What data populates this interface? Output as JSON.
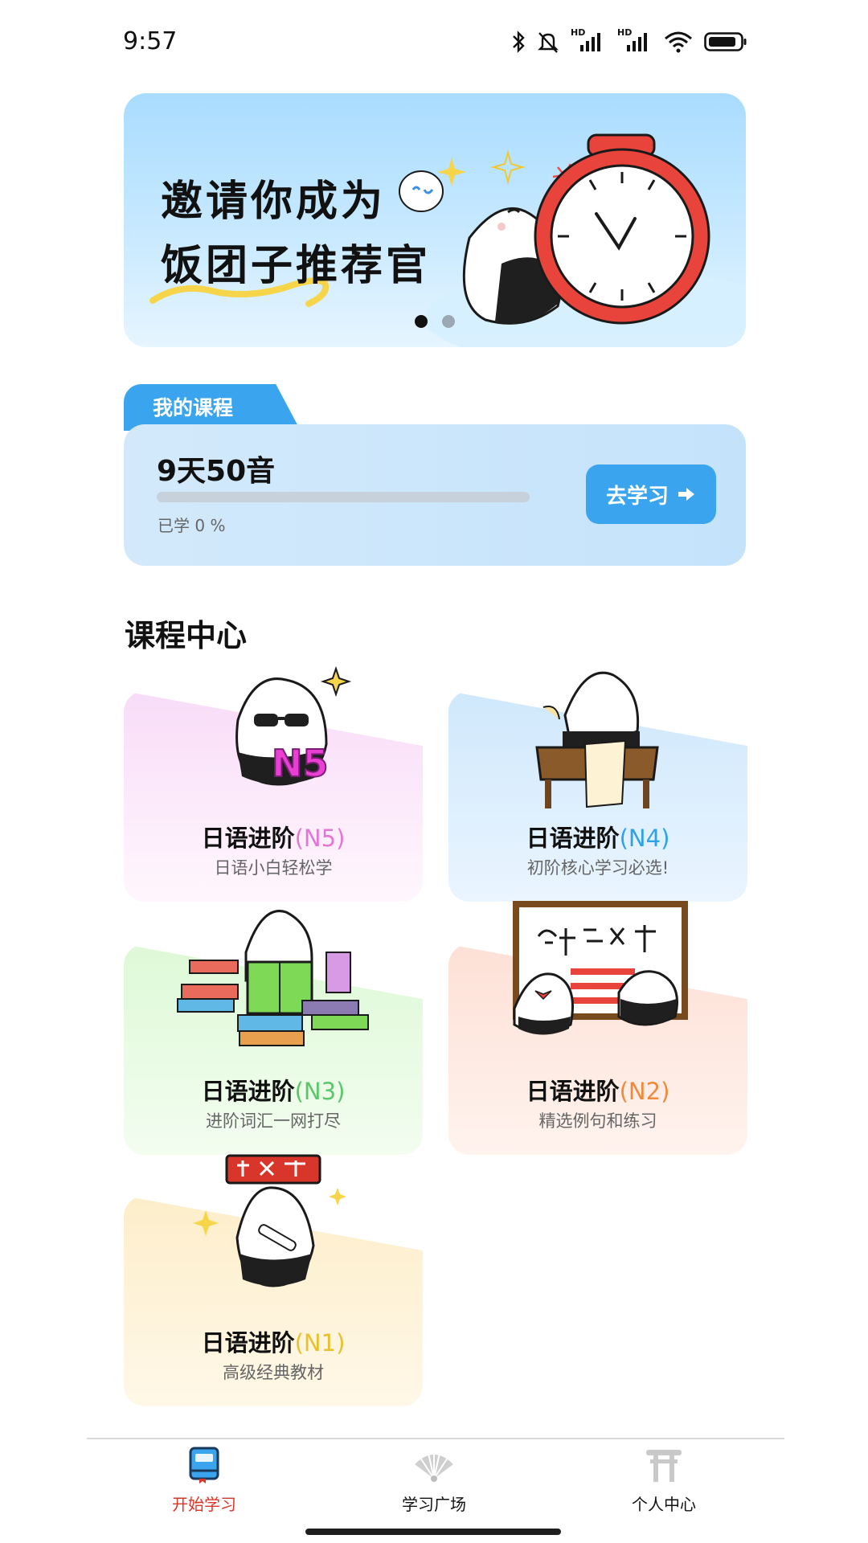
{
  "status_bar": {
    "time": "9:57",
    "icons": [
      "bluetooth-icon",
      "mute-bell-icon",
      "signal-hd-icon",
      "signal-hd-icon",
      "wifi-icon",
      "battery-icon"
    ]
  },
  "banner": {
    "line1": "邀请你成为",
    "line2": "饭团子推荐官",
    "dots": 2,
    "active_dot": 0
  },
  "my_course": {
    "tab_label": "我的课程",
    "title": "9天50音",
    "progress_text": "已学 0 %",
    "progress": 0,
    "button_label": "去学习"
  },
  "course_center": {
    "title": "课程中心",
    "courses": [
      {
        "name": "日语进阶",
        "level": "(N5)",
        "subtitle": "日语小白轻松学",
        "accent": "#e377d6",
        "bg_from": "#f8dcf8",
        "bg_to": "#fff7fd"
      },
      {
        "name": "日语进阶",
        "level": "(N4)",
        "subtitle": "初阶核心学习必选!",
        "accent": "#2fa2e6",
        "bg_from": "#cfe8fc",
        "bg_to": "#eaf5ff"
      },
      {
        "name": "日语进阶",
        "level": "(N3)",
        "subtitle": "进阶词汇一网打尽",
        "accent": "#5cc66a",
        "bg_from": "#def9d7",
        "bg_to": "#f3fdf0"
      },
      {
        "name": "日语进阶",
        "level": "(N2)",
        "subtitle": "精选例句和练习",
        "accent": "#ee8a3c",
        "bg_from": "#fde0d6",
        "bg_to": "#fff3ee"
      },
      {
        "name": "日语进阶",
        "level": "(N1)",
        "subtitle": "高级经典教材",
        "accent": "#e8c12c",
        "bg_from": "#fdeeca",
        "bg_to": "#fff8e8"
      }
    ]
  },
  "bottom_nav": {
    "items": [
      {
        "label": "开始学习",
        "icon": "book-icon",
        "active": true
      },
      {
        "label": "学习广场",
        "icon": "fan-icon",
        "active": false
      },
      {
        "label": "个人中心",
        "icon": "torii-icon",
        "active": false
      }
    ],
    "active_color": "#d9362b"
  }
}
